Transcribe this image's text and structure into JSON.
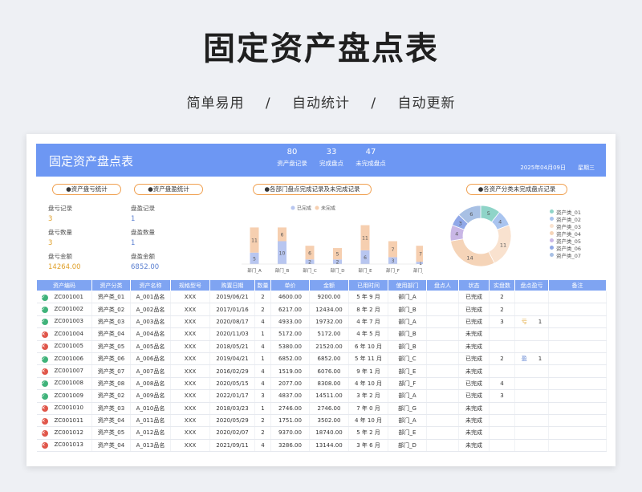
{
  "hero": {
    "title": "固定资产盘点表",
    "features": [
      "简单易用",
      "/",
      "自动统计",
      "/",
      "自动更新"
    ]
  },
  "banner": {
    "title": "固定资产盘点表",
    "stats": [
      {
        "value": "80",
        "label": "资产盘记录"
      },
      {
        "value": "33",
        "label": "完成盘点"
      },
      {
        "value": "47",
        "label": "未完成盘点"
      }
    ],
    "date": "2025年04月09日",
    "weekday": "星期三"
  },
  "panels": {
    "loss_title": "●资产盘亏统计",
    "gain_title": "●资产盘盈统计",
    "dept_title": "●各部门盘点完成记录及未完成记录",
    "cat_title": "●各资产分类未完成盘点记录"
  },
  "loss": {
    "count_label": "盘亏记录",
    "count": "3",
    "qty_label": "盘亏数量",
    "qty": "3",
    "amt_label": "盘亏金额",
    "amt": "14264.00"
  },
  "gain": {
    "count_label": "盘盈记录",
    "count": "1",
    "qty_label": "盘盈数量",
    "qty": "1",
    "amt_label": "盘盈金额",
    "amt": "6852.00"
  },
  "chart_data": [
    {
      "type": "bar",
      "categories": [
        "部门_A",
        "部门_B",
        "部门_C",
        "部门_D",
        "部门_E",
        "部门_F",
        "部门_G"
      ],
      "series": [
        {
          "name": "已完成",
          "values": [
            5,
            10,
            2,
            2,
            6,
            3,
            1
          ],
          "color": "#b8c6f0"
        },
        {
          "name": "未完成",
          "values": [
            11,
            6,
            6,
            5,
            11,
            7,
            7
          ],
          "color": "#f6cfb0"
        }
      ],
      "stacked": true,
      "legend_position": "top"
    },
    {
      "type": "pie",
      "donut": true,
      "labels": [
        "资产类_01",
        "资产类_02",
        "资产类_03",
        "资产类_04",
        "资产类_05",
        "资产类_06",
        "资产类_07"
      ],
      "values": [
        5,
        4,
        11,
        14,
        4,
        3,
        6
      ],
      "colors": [
        "#8fd4c8",
        "#a9c4ef",
        "#f9e2cf",
        "#f5d4b8",
        "#c9b7e6",
        "#90a8e8",
        "#a8c0e4"
      ],
      "legend_position": "right"
    }
  ],
  "table": {
    "headers": [
      "资产编码",
      "资产分类",
      "资产名称",
      "规格型号",
      "购置日期",
      "数量",
      "单价",
      "金额",
      "已用时间",
      "使用部门",
      "盘点人",
      "状态",
      "实盘数",
      "盘点盈亏",
      "备注"
    ],
    "rows": [
      {
        "ok": true,
        "code": "ZC001001",
        "cat": "资产类_01",
        "name": "A_001品名",
        "spec": "XXX",
        "date": "2019/06/21",
        "qty": "2",
        "price": "4600.00",
        "amt": "9200.00",
        "used": "5 年 9 月",
        "dept": "部门_A",
        "checker": "",
        "status": "已完成",
        "real": "2",
        "diff": "",
        "diffnum": "",
        "note": ""
      },
      {
        "ok": true,
        "code": "ZC001002",
        "cat": "资产类_02",
        "name": "A_002品名",
        "spec": "XXX",
        "date": "2017/01/16",
        "qty": "2",
        "price": "6217.00",
        "amt": "12434.00",
        "used": "8 年 2 月",
        "dept": "部门_B",
        "checker": "",
        "status": "已完成",
        "real": "2",
        "diff": "",
        "diffnum": "",
        "note": ""
      },
      {
        "ok": true,
        "code": "ZC001003",
        "cat": "资产类_03",
        "name": "A_003品名",
        "spec": "XXX",
        "date": "2020/08/17",
        "qty": "4",
        "price": "4933.00",
        "amt": "19732.00",
        "used": "4 年 7 月",
        "dept": "部门_A",
        "checker": "",
        "status": "已完成",
        "real": "3",
        "diff": "亏",
        "diffnum": "1",
        "note": ""
      },
      {
        "ok": false,
        "code": "ZC001004",
        "cat": "资产类_04",
        "name": "A_004品名",
        "spec": "XXX",
        "date": "2020/11/03",
        "qty": "1",
        "price": "5172.00",
        "amt": "5172.00",
        "used": "4 年 5 月",
        "dept": "部门_B",
        "checker": "",
        "status": "未完成",
        "real": "",
        "diff": "",
        "diffnum": "",
        "note": ""
      },
      {
        "ok": false,
        "code": "ZC001005",
        "cat": "资产类_05",
        "name": "A_005品名",
        "spec": "XXX",
        "date": "2018/05/21",
        "qty": "4",
        "price": "5380.00",
        "amt": "21520.00",
        "used": "6 年 10 月",
        "dept": "部门_B",
        "checker": "",
        "status": "未完成",
        "real": "",
        "diff": "",
        "diffnum": "",
        "note": ""
      },
      {
        "ok": true,
        "code": "ZC001006",
        "cat": "资产类_06",
        "name": "A_006品名",
        "spec": "XXX",
        "date": "2019/04/21",
        "qty": "1",
        "price": "6852.00",
        "amt": "6852.00",
        "used": "5 年 11 月",
        "dept": "部门_C",
        "checker": "",
        "status": "已完成",
        "real": "2",
        "diff": "盈",
        "diffnum": "1",
        "note": ""
      },
      {
        "ok": false,
        "code": "ZC001007",
        "cat": "资产类_07",
        "name": "A_007品名",
        "spec": "XXX",
        "date": "2016/02/29",
        "qty": "4",
        "price": "1519.00",
        "amt": "6076.00",
        "used": "9 年 1 月",
        "dept": "部门_E",
        "checker": "",
        "status": "未完成",
        "real": "",
        "diff": "",
        "diffnum": "",
        "note": ""
      },
      {
        "ok": true,
        "code": "ZC001008",
        "cat": "资产类_08",
        "name": "A_008品名",
        "spec": "XXX",
        "date": "2020/05/15",
        "qty": "4",
        "price": "2077.00",
        "amt": "8308.00",
        "used": "4 年 10 月",
        "dept": "部门_F",
        "checker": "",
        "status": "已完成",
        "real": "4",
        "diff": "",
        "diffnum": "",
        "note": ""
      },
      {
        "ok": true,
        "code": "ZC001009",
        "cat": "资产类_02",
        "name": "A_009品名",
        "spec": "XXX",
        "date": "2022/01/17",
        "qty": "3",
        "price": "4837.00",
        "amt": "14511.00",
        "used": "3 年 2 月",
        "dept": "部门_A",
        "checker": "",
        "status": "已完成",
        "real": "3",
        "diff": "",
        "diffnum": "",
        "note": ""
      },
      {
        "ok": false,
        "code": "ZC001010",
        "cat": "资产类_03",
        "name": "A_010品名",
        "spec": "XXX",
        "date": "2018/03/23",
        "qty": "1",
        "price": "2746.00",
        "amt": "2746.00",
        "used": "7 年 0 月",
        "dept": "部门_G",
        "checker": "",
        "status": "未完成",
        "real": "",
        "diff": "",
        "diffnum": "",
        "note": ""
      },
      {
        "ok": false,
        "code": "ZC001011",
        "cat": "资产类_04",
        "name": "A_011品名",
        "spec": "XXX",
        "date": "2020/05/29",
        "qty": "2",
        "price": "1751.00",
        "amt": "3502.00",
        "used": "4 年 10 月",
        "dept": "部门_A",
        "checker": "",
        "status": "未完成",
        "real": "",
        "diff": "",
        "diffnum": "",
        "note": ""
      },
      {
        "ok": false,
        "code": "ZC001012",
        "cat": "资产类_05",
        "name": "A_012品名",
        "spec": "XXX",
        "date": "2020/02/07",
        "qty": "2",
        "price": "9370.00",
        "amt": "18740.00",
        "used": "5 年 2 月",
        "dept": "部门_E",
        "checker": "",
        "status": "未完成",
        "real": "",
        "diff": "",
        "diffnum": "",
        "note": ""
      },
      {
        "ok": false,
        "code": "ZC001013",
        "cat": "资产类_04",
        "name": "A_013品名",
        "spec": "XXX",
        "date": "2021/09/11",
        "qty": "4",
        "price": "3286.00",
        "amt": "13144.00",
        "used": "3 年 6 月",
        "dept": "部门_D",
        "checker": "",
        "status": "未完成",
        "real": "",
        "diff": "",
        "diffnum": "",
        "note": ""
      }
    ]
  },
  "colors": {
    "banner": "#6d97f3",
    "header": "#7fa4f2",
    "accent_orange": "#e0a02a",
    "ok": "#3fb37a",
    "no": "#e0564a"
  }
}
